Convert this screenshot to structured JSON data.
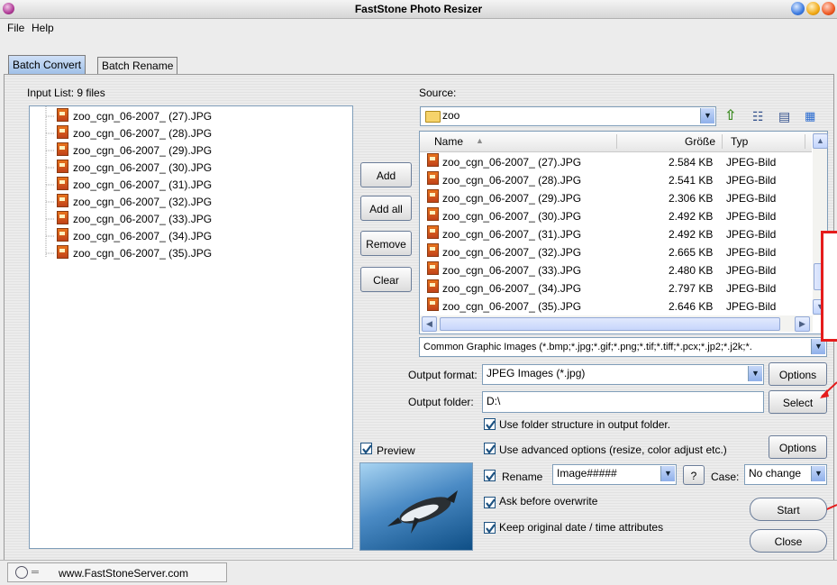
{
  "window": {
    "title": "FastStone Photo Resizer"
  },
  "menu": {
    "items": [
      "File",
      "Help"
    ]
  },
  "tabs": [
    "Batch Convert",
    "Batch Rename"
  ],
  "input_list": {
    "label": "Input List: 9 files",
    "files": [
      "zoo_cgn_06-2007_ (27).JPG",
      "zoo_cgn_06-2007_ (28).JPG",
      "zoo_cgn_06-2007_ (29).JPG",
      "zoo_cgn_06-2007_ (30).JPG",
      "zoo_cgn_06-2007_ (31).JPG",
      "zoo_cgn_06-2007_ (32).JPG",
      "zoo_cgn_06-2007_ (33).JPG",
      "zoo_cgn_06-2007_ (34).JPG",
      "zoo_cgn_06-2007_ (35).JPG"
    ]
  },
  "list_buttons": {
    "add": "Add",
    "add_all": "Add all",
    "remove": "Remove",
    "clear": "Clear"
  },
  "source": {
    "label": "Source:",
    "folder": "zoo",
    "columns": {
      "name": "Name",
      "size": "Größe",
      "type": "Typ"
    },
    "files": [
      {
        "name": "zoo_cgn_06-2007_ (27).JPG",
        "size": "2.584 KB",
        "type": "JPEG-Bild"
      },
      {
        "name": "zoo_cgn_06-2007_ (28).JPG",
        "size": "2.541 KB",
        "type": "JPEG-Bild"
      },
      {
        "name": "zoo_cgn_06-2007_ (29).JPG",
        "size": "2.306 KB",
        "type": "JPEG-Bild"
      },
      {
        "name": "zoo_cgn_06-2007_ (30).JPG",
        "size": "2.492 KB",
        "type": "JPEG-Bild"
      },
      {
        "name": "zoo_cgn_06-2007_ (31).JPG",
        "size": "2.492 KB",
        "type": "JPEG-Bild"
      },
      {
        "name": "zoo_cgn_06-2007_ (32).JPG",
        "size": "2.665 KB",
        "type": "JPEG-Bild"
      },
      {
        "name": "zoo_cgn_06-2007_ (33).JPG",
        "size": "2.480 KB",
        "type": "JPEG-Bild"
      },
      {
        "name": "zoo_cgn_06-2007_ (34).JPG",
        "size": "2.797 KB",
        "type": "JPEG-Bild"
      },
      {
        "name": "zoo_cgn_06-2007_ (35).JPG",
        "size": "2.646 KB",
        "type": "JPEG-Bild"
      }
    ],
    "filter": "Common Graphic Images (*.bmp;*.jpg;*.gif;*.png;*.tif;*.tiff;*.pcx;*.jp2;*.j2k;*."
  },
  "output": {
    "format_label": "Output format:",
    "format_value": "JPEG Images (*.jpg)",
    "options_label": "Options",
    "folder_label": "Output folder:",
    "folder_value": "D:\\",
    "select_label": "Select"
  },
  "options": {
    "preview": "Preview",
    "use_folder_structure": "Use folder structure in output folder.",
    "use_advanced": "Use advanced options (resize, color adjust etc.)",
    "advanced_options_label": "Options",
    "rename": "Rename",
    "rename_pattern": "Image#####",
    "help_label": "?",
    "case_label": "Case:",
    "case_value": "No change",
    "ask_overwrite": "Ask before overwrite",
    "keep_date": "Keep original date / time attributes"
  },
  "actions": {
    "start": "Start",
    "close": "Close"
  },
  "status": {
    "url": "www.FastStoneServer.com"
  },
  "colors": {
    "accent": "#9ebfe7",
    "checkbox": "#1c5180",
    "annotation": "#e51c1c"
  }
}
